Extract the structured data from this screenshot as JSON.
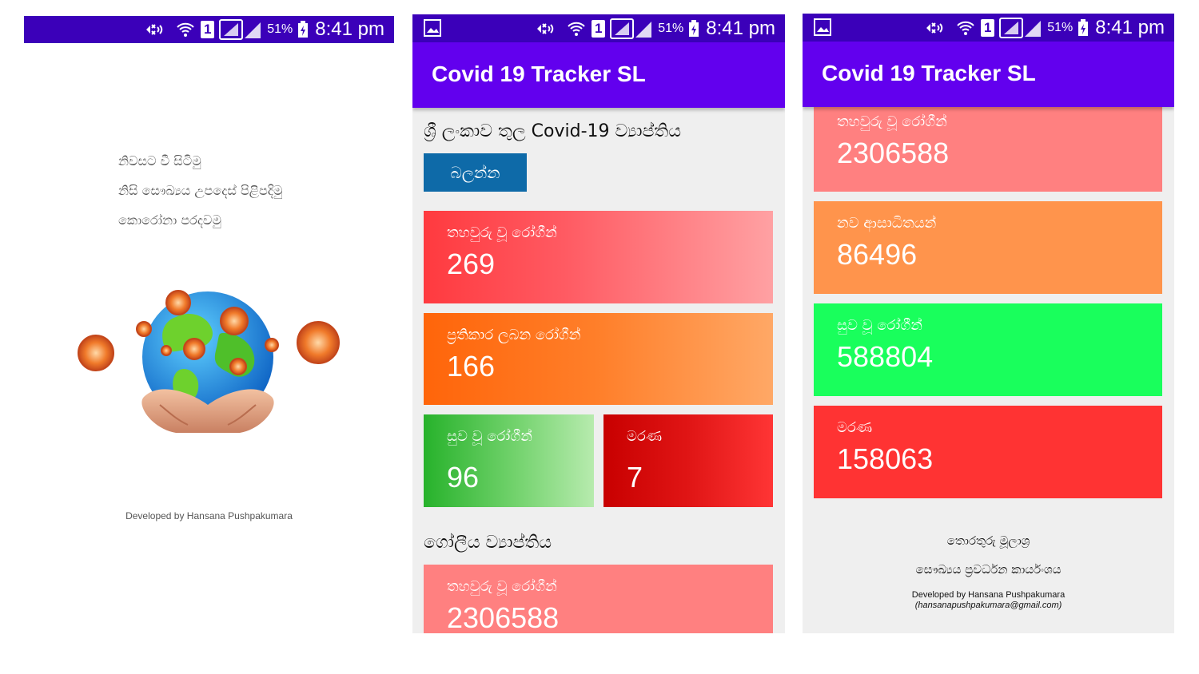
{
  "status_bar": {
    "battery": "51%",
    "time": "8:41 pm",
    "sim": "1"
  },
  "app": {
    "title": "Covid 19 Tracker SL"
  },
  "splash": {
    "lines": [
      "නිවසට වී සිටිමු",
      "නිසි සෞඛ්‍යය උපදෙස් පිළිපදිමු",
      "කොරෝනා පරදවමු"
    ],
    "credit": "Developed by Hansana Pushpakumara"
  },
  "local": {
    "title": "ශ්‍රී ලංකාව තුල Covid-19 ව්‍යාප්තිය",
    "view_button": "බලන්න",
    "confirmed": {
      "label": "තහවුරු වූ රෝගීන්",
      "value": "269"
    },
    "active": {
      "label": "ප්‍රතිකාර ලබන රෝගීන්",
      "value": "166"
    },
    "recovered": {
      "label": "සුව වූ රෝගීන්",
      "value": "96"
    },
    "deaths": {
      "label": "මරණ",
      "value": "7"
    }
  },
  "global": {
    "title": "ගෝලීය ව්‍යාප්තිය",
    "confirmed": {
      "label": "තහවුරු වූ රෝගීන්",
      "value": "2306588"
    },
    "new_cases": {
      "label": "නව ආසාධිතයන්",
      "value": "86496"
    },
    "recovered": {
      "label": "සුව වූ රෝගීන්",
      "value": "588804"
    },
    "deaths": {
      "label": "මරණ",
      "value": "158063"
    }
  },
  "footer": {
    "sources_heading": "තොරතුරු මූලාශ්‍ර",
    "source": "සෞඛ්‍යය ප්‍රවර්ධන කාර්යංශය",
    "developer": "Developed by Hansana Pushpakumara",
    "email": "(hansanapushpakumara@gmail.com)"
  },
  "colors": {
    "status_bar": "#3b00b9",
    "app_bar": "#6200ee",
    "button": "#0e6aa8",
    "confirmed": "#ff3b40",
    "active": "#ff6a10",
    "recovered": "#27b52b",
    "deaths": "#cc0000",
    "global_confirmed": "#ff8080",
    "global_new": "#ff944c",
    "global_recovered": "#19ff5c",
    "global_deaths": "#ff3333"
  },
  "icons": [
    "mute-icon",
    "wifi-icon",
    "sim-icon",
    "signal-icon",
    "battery-charging-icon",
    "gallery-icon"
  ]
}
